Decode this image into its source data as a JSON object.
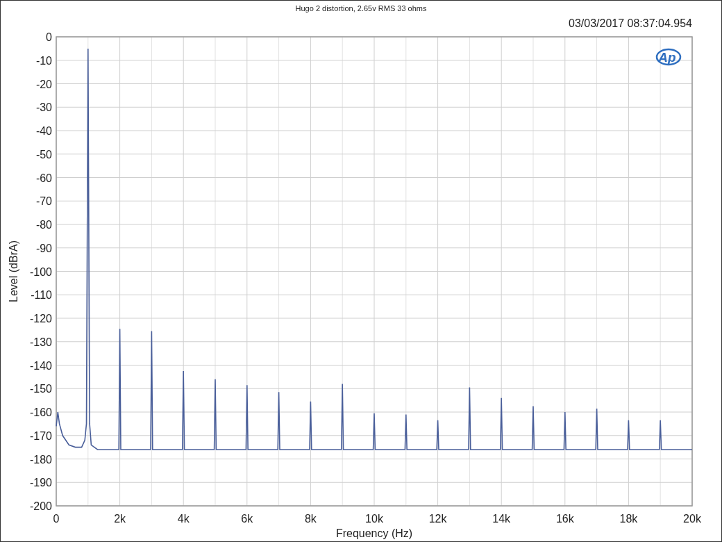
{
  "window": {
    "title": "Hugo 2 distortion, 2.65v RMS 33 ohms"
  },
  "timestamp": "03/03/2017 08:37:04.954",
  "logo": "Ap",
  "chart": {
    "chart_data": {
      "type": "line",
      "xlabel": "Frequency (Hz)",
      "ylabel": "Level (dBrA)",
      "x": [
        0,
        50,
        100,
        200,
        400,
        600,
        800,
        900,
        950,
        1000,
        1050,
        1100,
        1300,
        1970,
        2000,
        2030,
        2970,
        3000,
        3030,
        3970,
        4000,
        4030,
        4970,
        5000,
        5030,
        5970,
        6000,
        6030,
        6970,
        7000,
        7030,
        7970,
        8000,
        8030,
        8970,
        9000,
        9030,
        9970,
        10000,
        10030,
        10970,
        11000,
        11030,
        11970,
        12000,
        12030,
        12970,
        13000,
        13030,
        13970,
        14000,
        14030,
        14970,
        15000,
        15030,
        15970,
        16000,
        16030,
        16970,
        17000,
        17030,
        17970,
        18000,
        18030,
        18970,
        19000,
        19030,
        20000
      ],
      "grid": true,
      "series": [
        {
          "color": "#4a5f9a",
          "values": [
            -166,
            -160,
            -165,
            -170,
            -174,
            -175,
            -175,
            -172,
            -165,
            -5,
            -165,
            -174,
            -176,
            -176,
            -124.5,
            -176,
            -176,
            -125.5,
            -176,
            -176,
            -142.5,
            -176,
            -176,
            -146,
            -176,
            -176,
            -148.5,
            -176,
            -176,
            -151.5,
            -176,
            -176,
            -155.5,
            -176,
            -176,
            -148,
            -176,
            -176,
            -160.5,
            -176,
            -176,
            -161,
            -176,
            -176,
            -163.5,
            -176,
            -176,
            -149.5,
            -176,
            -176,
            -154,
            -176,
            -176,
            -157.5,
            -176,
            -176,
            -160,
            -176,
            -176,
            -158.5,
            -176,
            -176,
            -163.5,
            -176,
            -176,
            -163.5,
            -176,
            -176
          ]
        }
      ],
      "xlim": [
        0,
        20000
      ],
      "ylim": [
        -200,
        0
      ],
      "xticks": [
        {
          "value": 0,
          "label": "0"
        },
        {
          "value": 2000,
          "label": "2k"
        },
        {
          "value": 4000,
          "label": "4k"
        },
        {
          "value": 6000,
          "label": "6k"
        },
        {
          "value": 8000,
          "label": "8k"
        },
        {
          "value": 10000,
          "label": "10k"
        },
        {
          "value": 12000,
          "label": "12k"
        },
        {
          "value": 14000,
          "label": "14k"
        },
        {
          "value": 16000,
          "label": "16k"
        },
        {
          "value": 18000,
          "label": "18k"
        },
        {
          "value": 20000,
          "label": "20k"
        }
      ],
      "yticks": [
        0,
        -10,
        -20,
        -30,
        -40,
        -50,
        -60,
        -70,
        -80,
        -90,
        -100,
        -110,
        -120,
        -130,
        -140,
        -150,
        -160,
        -170,
        -180,
        -190,
        -200
      ]
    }
  }
}
